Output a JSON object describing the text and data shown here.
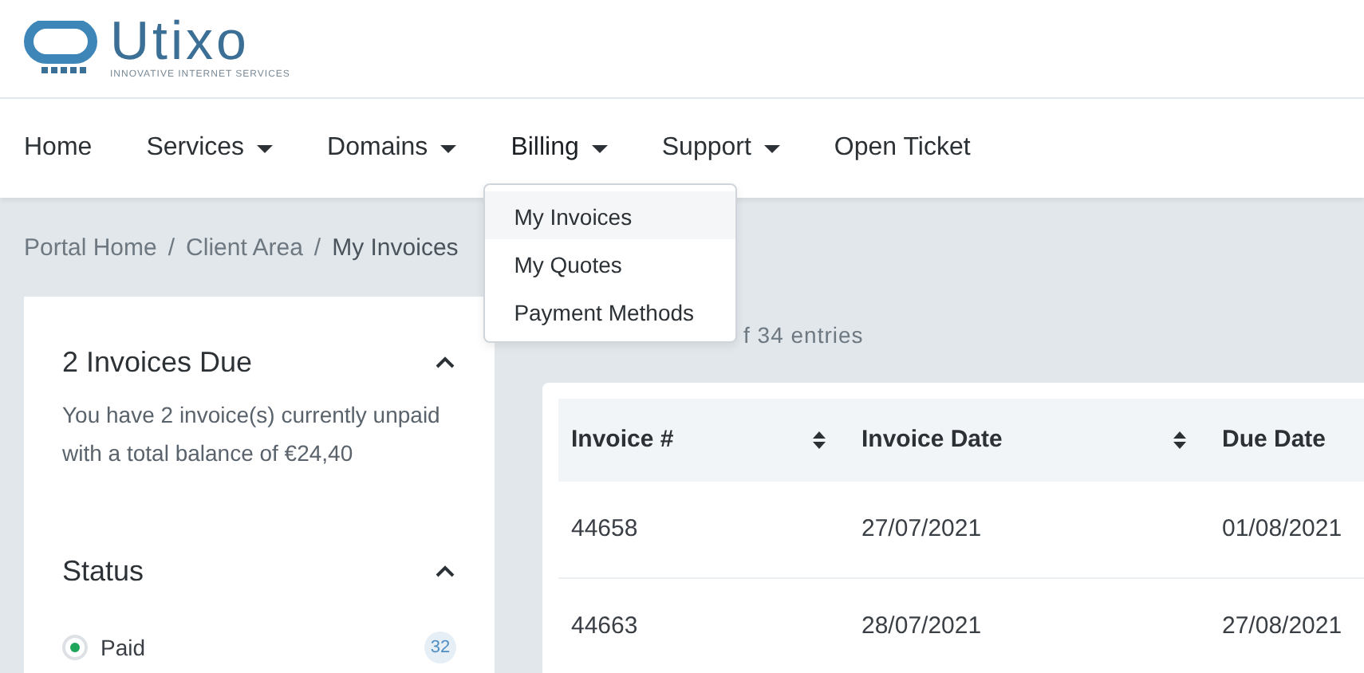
{
  "logo": {
    "name": "Utixo",
    "tagline": "INNOVATIVE INTERNET SERVICES"
  },
  "nav": [
    {
      "label": "Home",
      "kind": "link",
      "expanded": false
    },
    {
      "label": "Services",
      "kind": "dropdown",
      "expanded": false
    },
    {
      "label": "Domains",
      "kind": "dropdown",
      "expanded": false
    },
    {
      "label": "Billing",
      "kind": "dropdown",
      "expanded": true,
      "menu": [
        {
          "label": "My Invoices",
          "selected": true
        },
        {
          "label": "My Quotes",
          "selected": false
        },
        {
          "label": "Payment Methods",
          "selected": false
        }
      ]
    },
    {
      "label": "Support",
      "kind": "dropdown",
      "expanded": false
    },
    {
      "label": "Open Ticket",
      "kind": "link",
      "expanded": false
    }
  ],
  "breadcrumb": [
    {
      "kind": "link",
      "text": "Portal Home"
    },
    {
      "kind": "separator",
      "text": "/"
    },
    {
      "kind": "link",
      "text": "Client Area"
    },
    {
      "kind": "separator",
      "text": "/"
    },
    {
      "kind": "current",
      "text": "My Invoices"
    }
  ],
  "sidebar": [
    {
      "title": "2 Invoices Due",
      "expanded": true,
      "text": "You have 2 invoice(s) currently unpaid with a total balance of €24,40"
    },
    {
      "title": "Status",
      "expanded": true,
      "options": [
        {
          "label": "Paid",
          "checked": true,
          "count": "32"
        }
      ]
    }
  ],
  "table_info": "f 34 entries",
  "table": {
    "columns": [
      "Invoice #",
      "Invoice Date",
      "Due Date"
    ],
    "rows": [
      [
        "44658",
        "27/07/2021",
        "01/08/2021"
      ],
      [
        "44663",
        "28/07/2021",
        "27/08/2021"
      ]
    ]
  }
}
